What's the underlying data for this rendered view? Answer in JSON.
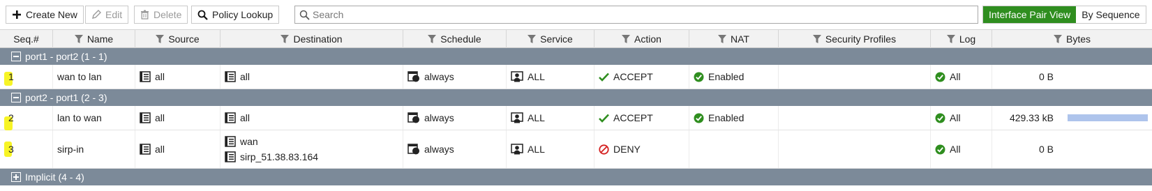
{
  "toolbar": {
    "create_new": "Create New",
    "edit": "Edit",
    "delete": "Delete",
    "policy_lookup": "Policy Lookup",
    "search_placeholder": "Search",
    "view_interface_pair": "Interface Pair View",
    "view_by_sequence": "By Sequence"
  },
  "columns": {
    "seq": "Seq.#",
    "name": "Name",
    "source": "Source",
    "destination": "Destination",
    "schedule": "Schedule",
    "service": "Service",
    "action": "Action",
    "nat": "NAT",
    "security_profiles": "Security Profiles",
    "log": "Log",
    "bytes": "Bytes"
  },
  "groups": [
    {
      "label": "port1 - port2 (1 - 1)",
      "expanded": true
    },
    {
      "label": "port2 - port1 (2 - 3)",
      "expanded": true
    },
    {
      "label": "Implicit (4 - 4)",
      "expanded": false
    }
  ],
  "rows": [
    {
      "seq": "1",
      "name": "wan to lan",
      "source": "all",
      "destination": [
        "all"
      ],
      "schedule": "always",
      "service": "ALL",
      "action": "ACCEPT",
      "nat": "Enabled",
      "security_profiles": "",
      "log": "All",
      "bytes": "0 B",
      "traffic_bar": 0
    },
    {
      "seq": "2",
      "name": "lan to wan",
      "source": "all",
      "destination": [
        "all"
      ],
      "schedule": "always",
      "service": "ALL",
      "action": "ACCEPT",
      "nat": "Enabled",
      "security_profiles": "",
      "log": "All",
      "bytes": "429.33 kB",
      "traffic_bar": 1.0
    },
    {
      "seq": "3",
      "name": "sirp-in",
      "source": "all",
      "destination": [
        "wan",
        "sirp_51.38.83.164"
      ],
      "schedule": "always",
      "service": "ALL",
      "action": "DENY",
      "nat": "",
      "security_profiles": "",
      "log": "All",
      "bytes": "0 B",
      "traffic_bar": 0
    }
  ],
  "colors": {
    "accent_green": "#2f8e1f",
    "group_header": "#7c8a99",
    "accept_check": "#2f8e1f",
    "deny_red": "#d42020",
    "bytes_bar": "#aec4ec",
    "seq_highlight": "#f6f200"
  },
  "icons": {
    "create": "plus-icon",
    "edit": "pencil-icon",
    "delete": "trash-icon",
    "lookup": "magnifier-icon",
    "address": "address-object-icon",
    "schedule": "schedule-icon",
    "service": "service-icon",
    "accept": "checkmark-icon",
    "deny": "deny-icon",
    "enabled": "check-circle-icon"
  }
}
